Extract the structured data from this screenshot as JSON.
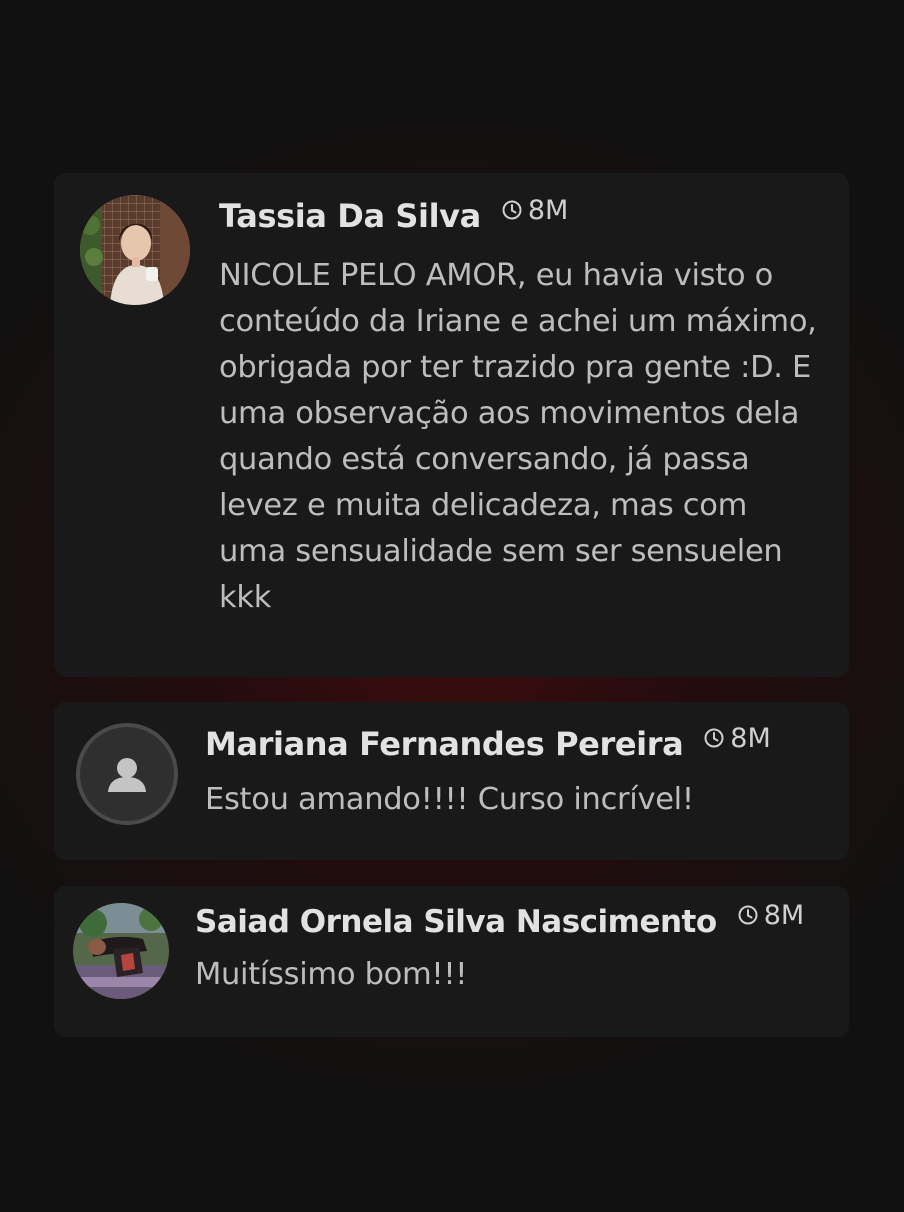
{
  "comments": [
    {
      "author": "Tassia Da Silva",
      "time": "8M",
      "text": "NICOLE PELO AMOR, eu havia visto o conteúdo da Iriane e achei um máximo, obrigada por ter trazido pra gente :D. E uma observação aos movimentos dela quando está conversando, já passa levez e muita delicadeza, mas com uma sensualidade sem ser sensuelen kkk",
      "avatar": "photo"
    },
    {
      "author": "Mariana Fernandes Pereira",
      "time": "8M",
      "text": "Estou amando!!!! Curso incrível!",
      "avatar": "default-user-icon"
    },
    {
      "author": "Saiad Ornela Silva Nascimento",
      "time": "8M",
      "text": "Muitíssimo bom!!!",
      "avatar": "photo"
    }
  ],
  "colors": {
    "background": "#111111",
    "glow": "#420c0e",
    "card": "#191919",
    "author": "#e2e2e2",
    "body": "#bdbdbd"
  }
}
